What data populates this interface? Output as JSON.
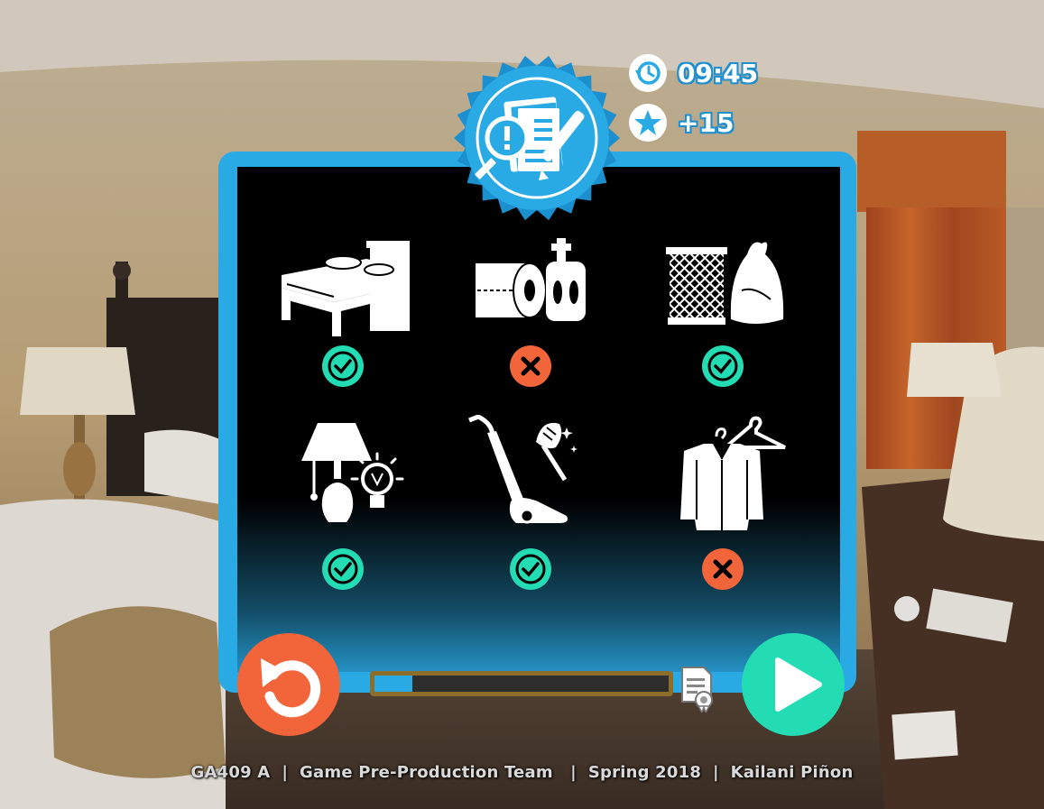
{
  "hud": {
    "timer": "09:45",
    "score": "+15",
    "timer_icon": "clock-history-icon",
    "score_icon": "star-icon"
  },
  "badge_icon": "checklist-pen-icon",
  "tasks": [
    {
      "name": "bed",
      "icon": "bed-icon",
      "status": "done"
    },
    {
      "name": "toiletries",
      "icon": "toilet-paper-soap-icon",
      "status": "failed"
    },
    {
      "name": "trash",
      "icon": "trash-bin-bag-icon",
      "status": "done"
    },
    {
      "name": "lamp",
      "icon": "lamp-lightbulb-icon",
      "status": "done"
    },
    {
      "name": "vacuum",
      "icon": "vacuum-duster-icon",
      "status": "done"
    },
    {
      "name": "clothes",
      "icon": "clothes-hanger-icon",
      "status": "failed"
    }
  ],
  "progress": {
    "value": 0.13
  },
  "buttons": {
    "restart_icon": "restart-arrow-icon",
    "play_icon": "play-icon",
    "certificate_icon": "certificate-icon"
  },
  "footer": "GA409 A  |  Game Pre-Production Team   |  Spring 2018  |  Kailani Piñon",
  "colors": {
    "accent": "#2aaae4",
    "success": "#24dcb3",
    "fail": "#f2653a"
  }
}
